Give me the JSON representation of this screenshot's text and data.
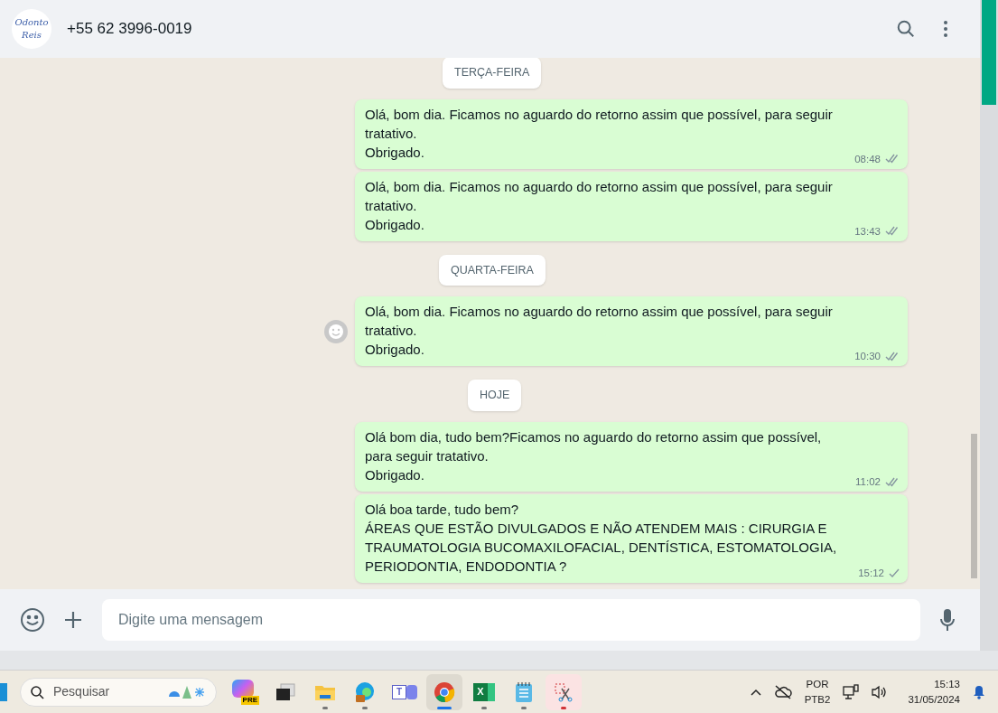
{
  "header": {
    "avatar_text": [
      "Odonto",
      "Reis"
    ],
    "contact": "+55 62 3996-0019"
  },
  "messages": [
    {
      "kind": "date",
      "label": "TERÇA-FEIRA"
    },
    {
      "kind": "message",
      "lines": [
        "Olá, bom dia. Ficamos no aguardo do retorno assim que possível, para seguir tratativo.",
        "Obrigado."
      ],
      "time": "08:48",
      "delivered": true,
      "reaction": false
    },
    {
      "kind": "message",
      "lines": [
        "Olá, bom dia. Ficamos no aguardo do retorno assim que possível, para seguir tratativo.",
        "Obrigado."
      ],
      "time": "13:43",
      "delivered": true,
      "reaction": false
    },
    {
      "kind": "date",
      "label": "QUARTA-FEIRA"
    },
    {
      "kind": "message",
      "lines": [
        "Olá, bom dia. Ficamos no aguardo do retorno assim que possível, para seguir tratativo.",
        "Obrigado."
      ],
      "time": "10:30",
      "delivered": true,
      "reaction": true
    },
    {
      "kind": "date",
      "label": "HOJE"
    },
    {
      "kind": "message",
      "lines": [
        "Olá bom dia, tudo bem?Ficamos no aguardo do retorno assim que possível, para seguir tratativo.",
        "Obrigado."
      ],
      "time": "11:02",
      "delivered": true,
      "reaction": false
    },
    {
      "kind": "message",
      "lines": [
        "Olá boa tarde, tudo bem?",
        "ÁREAS QUE ESTÃO DIVULGADOS E NÃO ATENDEM MAIS : CIRURGIA E TRAUMATOLOGIA BUCOMAXILOFACIAL, DENTÍSTICA, ESTOMATOLOGIA, PERIODONTIA, ENDODONTIA ?"
      ],
      "time": "15:12",
      "delivered": false,
      "reaction": false
    }
  ],
  "composer": {
    "placeholder": "Digite uma mensagem"
  },
  "taskbar": {
    "search": {
      "placeholder": "Pesquisar"
    },
    "apps": [
      {
        "kind": "copilot",
        "badge": "PRE",
        "running": false,
        "selected": false
      },
      {
        "kind": "taskview",
        "running": false,
        "selected": false
      },
      {
        "kind": "folder",
        "running": true,
        "selected": false
      },
      {
        "kind": "edge",
        "running": true,
        "selected": false
      },
      {
        "kind": "teams",
        "badge": "T",
        "running": false,
        "selected": false
      },
      {
        "kind": "chrome",
        "running": true,
        "selected": true
      },
      {
        "kind": "excel",
        "badge": "X",
        "running": true,
        "selected": false
      },
      {
        "kind": "notepad",
        "running": true,
        "selected": false
      },
      {
        "kind": "snip",
        "running": true,
        "selected": true
      }
    ],
    "language": [
      "POR",
      "PTB2"
    ],
    "time": "15:13",
    "date": "31/05/2024"
  }
}
